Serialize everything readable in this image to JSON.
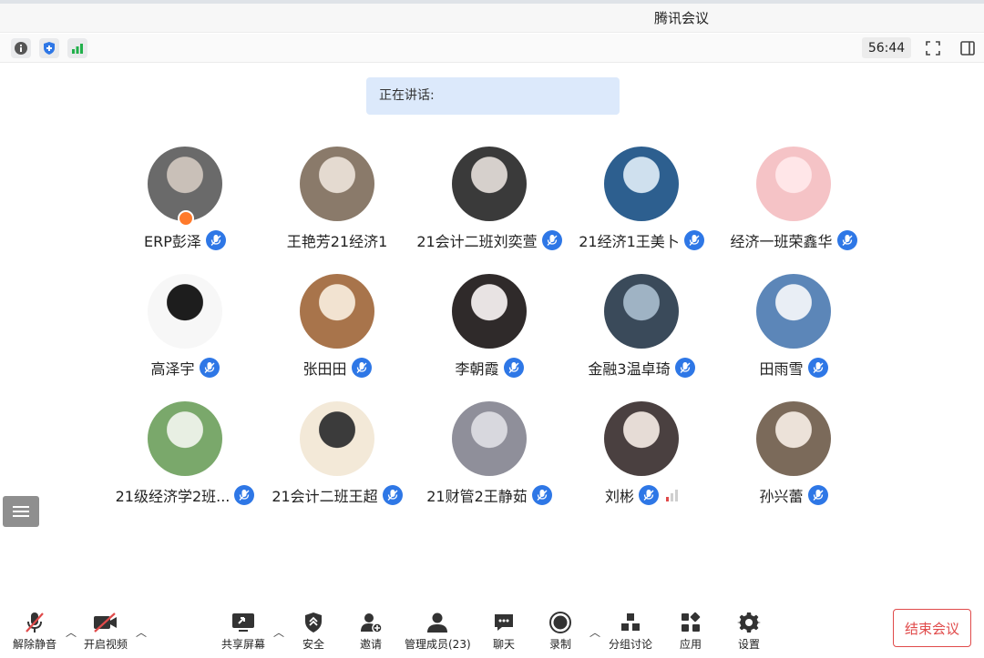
{
  "window": {
    "title": "腾讯会议"
  },
  "status": {
    "timer": "56:44",
    "icons": [
      "info-icon",
      "shield-icon",
      "signal-icon",
      "fullscreen-icon",
      "sidebar-toggle-icon"
    ]
  },
  "speaking": {
    "label": "正在讲话:"
  },
  "participants": [
    {
      "name": "ERP彭泽",
      "mic": "blue",
      "host": true
    },
    {
      "name": "王艳芳21经济1",
      "mic": "none"
    },
    {
      "name": "21会计二班刘奕萱",
      "mic": "blue"
    },
    {
      "name": "21经济1王美卜",
      "mic": "blue"
    },
    {
      "name": "经济一班荣鑫华",
      "mic": "blue"
    },
    {
      "name": "高泽宇",
      "mic": "blue"
    },
    {
      "name": "张田田",
      "mic": "blue"
    },
    {
      "name": "李朝霞",
      "mic": "blue"
    },
    {
      "name": "金融3温卓琦",
      "mic": "blue"
    },
    {
      "name": "田雨雪",
      "mic": "blue"
    },
    {
      "name": "21级经济学2班...",
      "mic": "blue"
    },
    {
      "name": "21会计二班王超",
      "mic": "blue"
    },
    {
      "name": "21财管2王静茹",
      "mic": "blue"
    },
    {
      "name": "刘彬",
      "mic": "blue",
      "signal": true
    },
    {
      "name": "孙兴蕾",
      "mic": "blue"
    }
  ],
  "toolbar": {
    "unmute": "解除静音",
    "start_video": "开启视频",
    "share_screen": "共享屏幕",
    "security": "安全",
    "invite": "邀请",
    "manage_members": "管理成员(23)",
    "chat": "聊天",
    "record": "录制",
    "breakout": "分组讨论",
    "apps": "应用",
    "settings": "设置",
    "end_meeting": "结束会议"
  },
  "colors": {
    "accent": "#2e77e6",
    "danger": "#e04a4a",
    "speaking_bg": "#dce9fb"
  }
}
